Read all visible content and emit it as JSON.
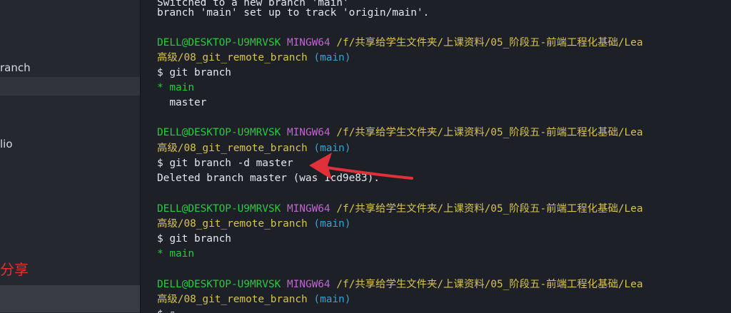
{
  "sidebar": {
    "items": [
      {
        "label": "ranch"
      },
      {
        "label": "lio"
      }
    ],
    "share_label": "分享"
  },
  "terminal": {
    "top_lines": [
      "Switched to a new branch 'main'",
      "branch 'main' set up to track 'origin/main'."
    ],
    "prompt": {
      "user_host": "DELL@DESKTOP-U9MRVSK",
      "shell": "MINGW64",
      "path_line1": "/f/共享给学生文件夹/上课资料/05_阶段五-前端工程化基础/Lea",
      "path_line2": "高级/08_git_remote_branch",
      "branch": "(main)"
    },
    "blocks": [
      {
        "command": "$ git branch",
        "outputs": [
          {
            "text": "* main",
            "color": "green"
          },
          {
            "text": "  master",
            "color": "white"
          }
        ]
      },
      {
        "command": "$ git branch -d master",
        "outputs": [
          {
            "text": "Deleted branch master (was 1cd9e83).",
            "color": "white"
          }
        ]
      },
      {
        "command": "$ git branch",
        "outputs": [
          {
            "text": "* main",
            "color": "green"
          }
        ]
      },
      {
        "command": "$ ▯",
        "outputs": []
      }
    ]
  },
  "annotation": {
    "arrow_color": "#e0303a",
    "meaning": "red-arrow"
  }
}
